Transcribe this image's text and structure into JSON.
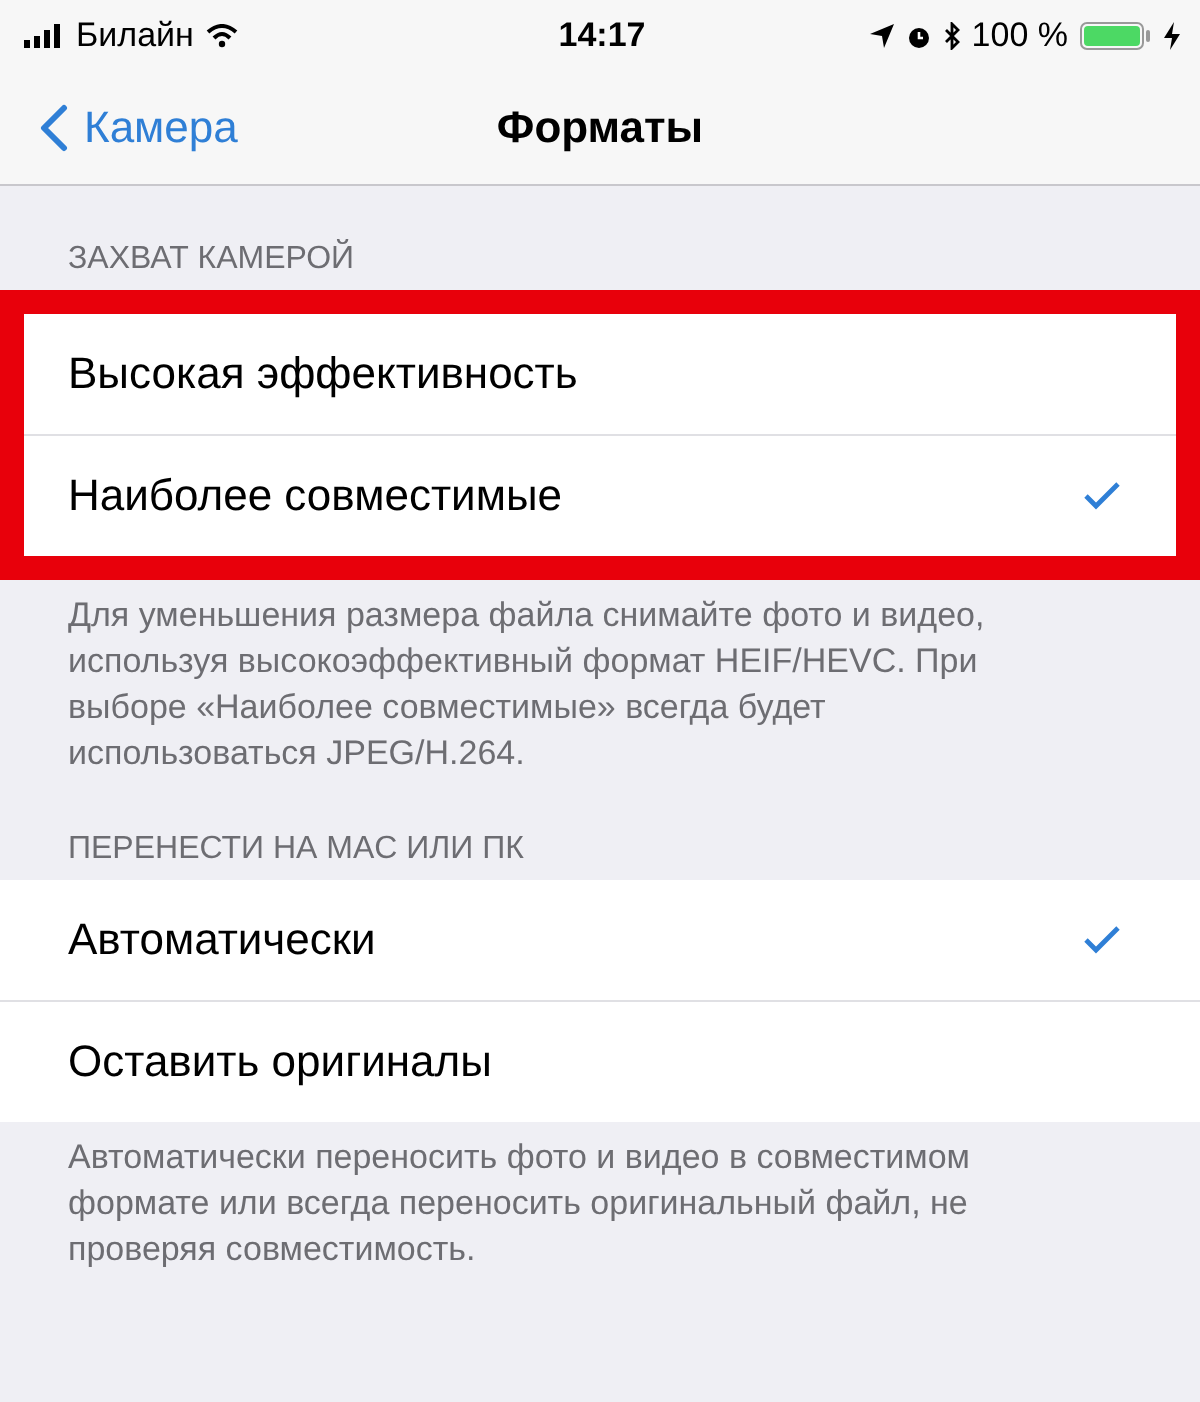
{
  "status_bar": {
    "carrier": "Билайн",
    "time": "14:17",
    "battery": "100 %"
  },
  "nav": {
    "back": "Камера",
    "title": "Форматы"
  },
  "sections": [
    {
      "header": "ЗАХВАТ КАМЕРОЙ",
      "highlighted": true,
      "rows": [
        {
          "label": "Высокая эффективность",
          "selected": false
        },
        {
          "label": "Наиболее совместимые",
          "selected": true
        }
      ],
      "footer": "Для уменьшения размера файла снимайте фото и видео, используя высокоэффективный формат HEIF/HEVC. При выборе «Наиболее совместимые» всегда будет использоваться JPEG/H.264."
    },
    {
      "header": "ПЕРЕНЕСТИ НА MAC ИЛИ ПК",
      "highlighted": false,
      "rows": [
        {
          "label": "Автоматически",
          "selected": true
        },
        {
          "label": "Оставить оригиналы",
          "selected": false
        }
      ],
      "footer": "Автоматически переносить фото и видео в совместимом формате или всегда переносить оригинальный файл, не проверяя совместимость."
    }
  ]
}
